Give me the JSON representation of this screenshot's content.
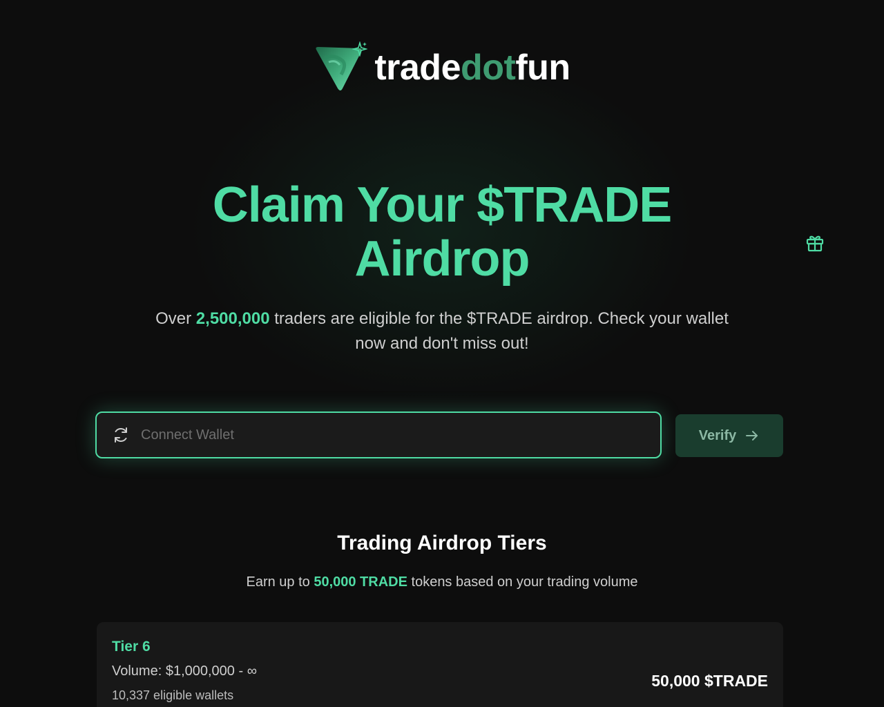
{
  "brand": {
    "name_prefix": "trade",
    "name_mid": "dot",
    "name_suffix": "fun",
    "logo_icon": "triangle-logo-icon",
    "sparkle_icon": "sparkle-icon"
  },
  "colors": {
    "accent": "#4fdca4",
    "background": "#0d0d0d",
    "card": "#181818",
    "verify_bg": "#1a3d2e"
  },
  "hero": {
    "title_line1": "Claim Your $TRADE",
    "title_line2": "Airdrop",
    "subtitle_pre": "Over ",
    "subtitle_highlight": "2,500,000",
    "subtitle_post": " traders are eligible for the $TRADE airdrop. Check your wallet now and don't miss out!"
  },
  "side": {
    "gift_icon": "gift-icon"
  },
  "wallet": {
    "icon": "refresh-icon",
    "placeholder": "Connect Wallet",
    "verify_label": "Verify",
    "verify_icon": "arrow-right-icon"
  },
  "tiers": {
    "title": "Trading Airdrop Tiers",
    "subtitle_pre": "Earn up to ",
    "subtitle_highlight": "50,000 TRADE",
    "subtitle_post": " tokens based on your trading volume",
    "items": [
      {
        "name": "Tier 6",
        "volume": "Volume: $1,000,000 - ∞",
        "wallets": "10,337 eligible wallets",
        "reward": "50,000 $TRADE"
      }
    ]
  }
}
